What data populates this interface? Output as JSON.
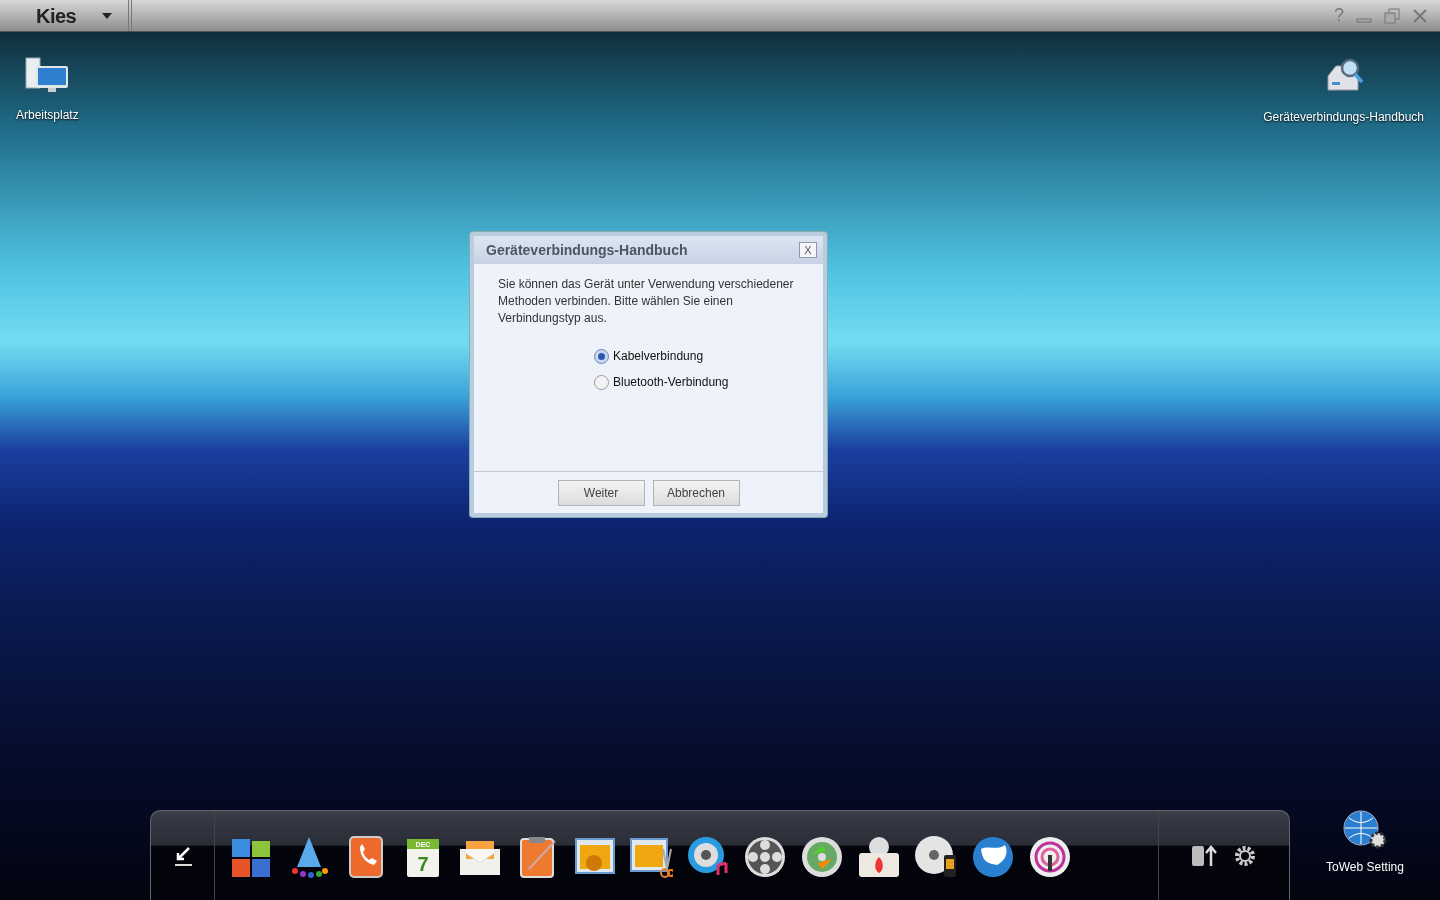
{
  "title_bar": {
    "logo": "Kies",
    "controls": [
      "?"
    ]
  },
  "desktop_icons": [
    {
      "label": "Arbeitsplatz",
      "kind": "computer"
    },
    {
      "label": "Geräteverbindungs-Handbuch",
      "kind": "guide"
    }
  ],
  "dialog": {
    "title": "Geräteverbindungs-Handbuch",
    "close": "X",
    "message": "Sie können das Gerät unter Verwendung verschiedener Methoden verbinden. Bitte wählen Sie einen Verbindungstyp aus.",
    "options": [
      {
        "label": "Kabelverbindung",
        "selected": true
      },
      {
        "label": "Bluetooth-Verbindung",
        "selected": false
      }
    ],
    "buttons": [
      "Weiter",
      "Abbrechen"
    ]
  },
  "dock": {
    "calendar_month": "DEC",
    "calendar_day": "7"
  },
  "corner_icon": {
    "label": "ToWeb Setting"
  }
}
